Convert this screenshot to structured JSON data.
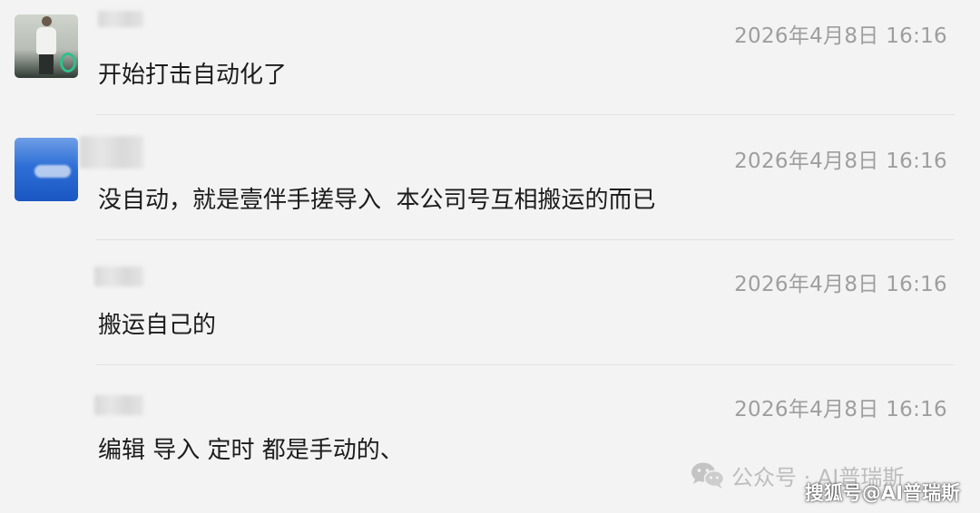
{
  "comments": [
    {
      "avatar": "avatar-photo-person",
      "timestamp": "2026年4月8日 16:16",
      "text": "开始打击自动化了"
    },
    {
      "avatar": "avatar-photo-blue-sky",
      "timestamp": "2026年4月8日 16:16",
      "text": "没自动，就是壹伴手搓导入  本公司号互相搬运的而已"
    },
    {
      "avatar": "",
      "timestamp": "2026年4月8日 16:16",
      "text": "搬运自己的"
    },
    {
      "avatar": "",
      "timestamp": "2026年4月8日 16:16",
      "text": "编辑 导入 定时 都是手动的、"
    }
  ],
  "watermark": {
    "icon": "wechat-icon",
    "text": "公众号 · AI普瑞斯"
  },
  "footer": {
    "text": "搜狐号@AI普瑞斯"
  },
  "colors": {
    "background": "#f3f3f3",
    "text": "#1c1c1c",
    "timestamp": "#9e9e9e",
    "divider": "#e2e2e2"
  }
}
